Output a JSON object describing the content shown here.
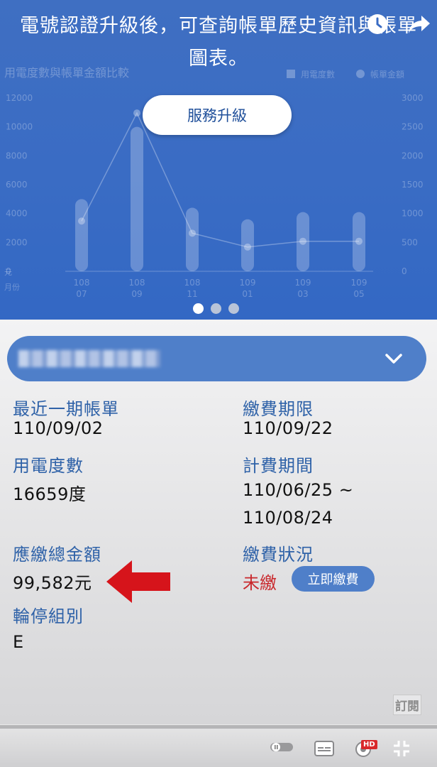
{
  "hero": {
    "line1": "電號認證升級後，可查詢帳單歷史資訊與帳單",
    "line2": "圖表。",
    "upgrade_button": "服務升級"
  },
  "chart_data": {
    "type": "bar",
    "title": "用電度數與帳單金額比較",
    "legend": [
      "用電度數",
      "帳單金額"
    ],
    "legend_placement": "top-right",
    "left_axis_ticks": [
      "12000",
      "10000",
      "8000",
      "6000",
      "4000",
      "2000",
      "0"
    ],
    "left_axis_unit": "元",
    "right_axis_ticks": [
      "3000",
      "2500",
      "2000",
      "1500",
      "1000",
      "500",
      "0"
    ],
    "x_axis_label": "月份",
    "categories": [
      "108\n07",
      "108\n09",
      "108\n11",
      "109\n01",
      "109\n03",
      "109\n05"
    ],
    "category_top": [
      "108",
      "108",
      "108",
      "109",
      "109",
      "109"
    ],
    "category_bottom": [
      "07",
      "09",
      "11",
      "01",
      "03",
      "05"
    ],
    "ylim_left": [
      0,
      12000
    ],
    "ylim_right": [
      0,
      3000
    ],
    "series": [
      {
        "name": "用電度數",
        "type": "bar",
        "values": [
          5000,
          10000,
          4400,
          3600,
          4100,
          4100
        ]
      },
      {
        "name": "帳單金額",
        "type": "line",
        "values": [
          870,
          2740,
          660,
          420,
          520,
          520
        ]
      }
    ]
  },
  "account": {
    "name": "████ (████)"
  },
  "bill": {
    "latest_label": "最近一期帳單",
    "latest_value": "110/09/02",
    "due_label": "繳費期限",
    "due_value": "110/09/22",
    "usage_label": "用電度數",
    "usage_value": "16659度",
    "period_label": "計費期間",
    "period_start": "110/06/25 ~",
    "period_end": "110/08/24",
    "total_label": "應繳總金額",
    "total_value": "99,582元",
    "status_label": "繳費狀況",
    "status_value": "未繳",
    "pay_button": "立即繳費",
    "group_label": "輪停組別",
    "group_value": "E"
  },
  "subscribe_label": "訂閱",
  "player": {
    "hd_badge": "HD",
    "progress_fraction": 0.0
  },
  "colors": {
    "hero_blue": "#3a6cc4",
    "label_blue": "#2f62a8",
    "unpaid_red": "#c9282c",
    "button_blue": "#4f7fc9"
  }
}
